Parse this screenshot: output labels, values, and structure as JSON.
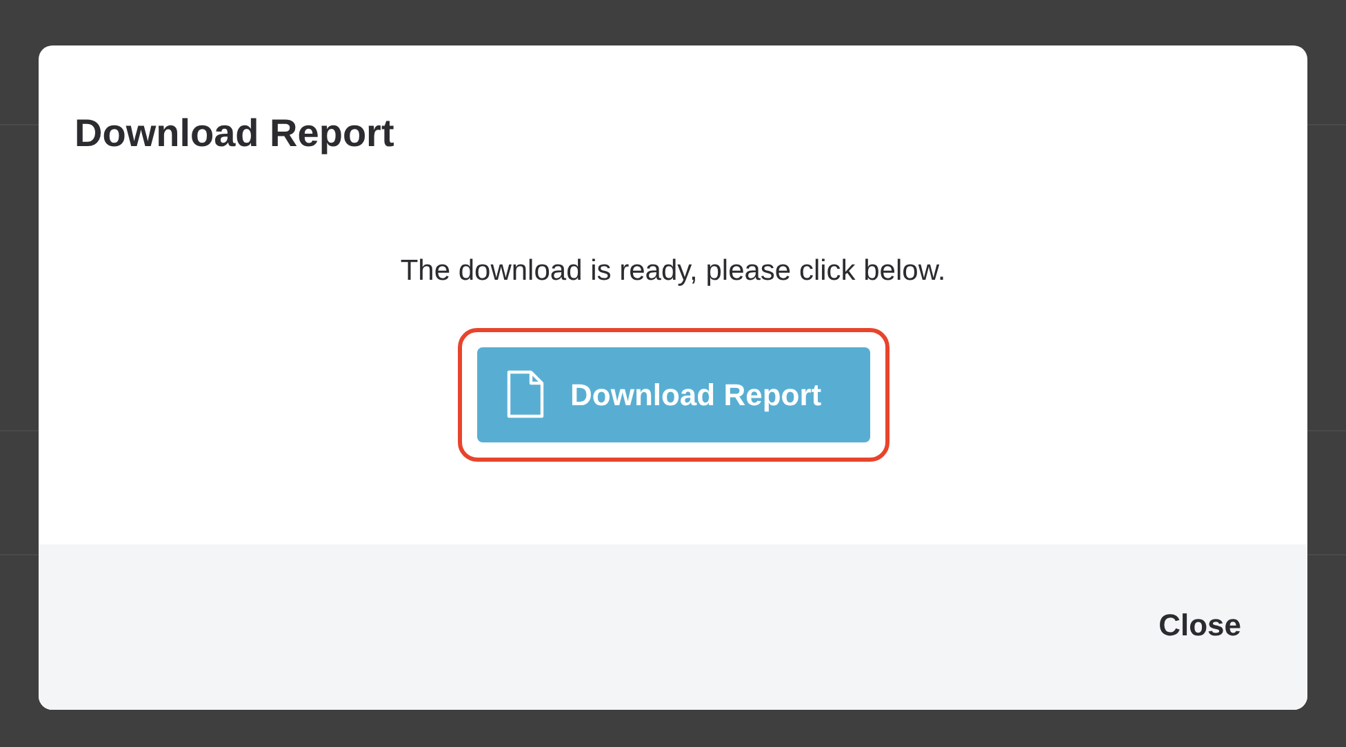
{
  "dialog": {
    "title": "Download Report",
    "message": "The download is ready, please click below.",
    "download_button": {
      "label": "Download Report",
      "highlighted": true
    },
    "footer": {
      "close_button": {
        "label": "Close"
      }
    }
  }
}
